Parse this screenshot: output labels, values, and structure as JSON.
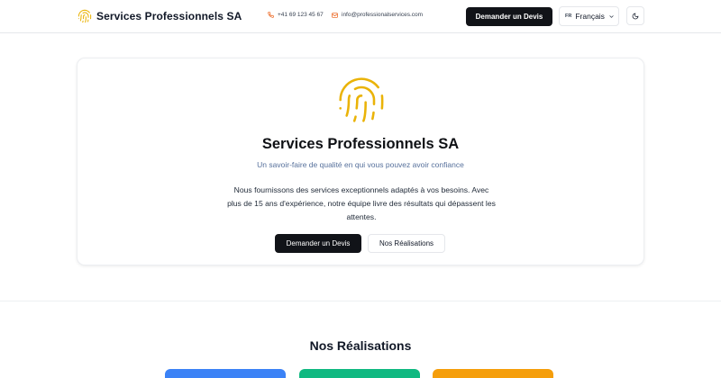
{
  "header": {
    "brand": "Services Professionnels SA",
    "phone": "+41 69 123 45 67",
    "email": "info@professionalservices.com",
    "quote_button": "Demander un Devis",
    "language": {
      "code": "FR",
      "name": "Français"
    },
    "icons": {
      "logo": "fingerprint-icon",
      "phone": "phone-icon",
      "email": "mail-icon",
      "dropdown": "chevron-down-icon",
      "theme": "moon-icon"
    }
  },
  "hero": {
    "title": "Services Professionnels SA",
    "subtitle": "Un savoir-faire de qualité en qui vous pouvez avoir confiance",
    "description": "Nous fournissons des services exceptionnels adaptés à vos besoins. Avec plus de 15 ans d'expérience, notre équipe livre des résultats qui dépassent les attentes.",
    "primary_button": "Demander un Devis",
    "secondary_button": "Nos Réalisations"
  },
  "realisations": {
    "title": "Nos Réalisations",
    "cards": [
      {
        "color": "#3b82f6"
      },
      {
        "color": "#10b981"
      },
      {
        "color": "#f59e0b"
      }
    ]
  },
  "colors": {
    "accent": "#eab308",
    "button_dark": "#111318",
    "subtitle": "#56709b"
  }
}
